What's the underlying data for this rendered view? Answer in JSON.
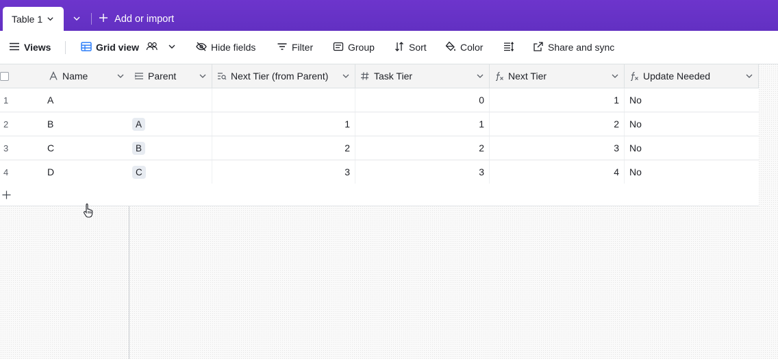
{
  "tabbar": {
    "active_tab": "Table 1",
    "add_label": "Add or import"
  },
  "toolbar": {
    "views": "Views",
    "grid_view": "Grid view",
    "hide_fields": "Hide fields",
    "filter": "Filter",
    "group": "Group",
    "sort": "Sort",
    "color": "Color",
    "share": "Share and sync"
  },
  "columns": [
    {
      "label": "Name",
      "icon": "text-icon"
    },
    {
      "label": "Parent",
      "icon": "link-icon"
    },
    {
      "label": "Next Tier (from Parent)",
      "icon": "lookup-icon"
    },
    {
      "label": "Task Tier",
      "icon": "number-icon"
    },
    {
      "label": "Next Tier",
      "icon": "formula-icon"
    },
    {
      "label": "Update Needed",
      "icon": "formula-icon"
    }
  ],
  "rows": [
    {
      "num": "1",
      "name": "A",
      "parent": "",
      "next_from_parent": "",
      "task_tier": "0",
      "next_tier": "1",
      "update": "No"
    },
    {
      "num": "2",
      "name": "B",
      "parent": "A",
      "next_from_parent": "1",
      "task_tier": "1",
      "next_tier": "2",
      "update": "No"
    },
    {
      "num": "3",
      "name": "C",
      "parent": "B",
      "next_from_parent": "2",
      "task_tier": "2",
      "next_tier": "3",
      "update": "No"
    },
    {
      "num": "4",
      "name": "D",
      "parent": "C",
      "next_from_parent": "3",
      "task_tier": "3",
      "next_tier": "4",
      "update": "No"
    }
  ],
  "colors": {
    "tabbar": "#6a33c9",
    "grid_icon": "#2d7ff9"
  }
}
